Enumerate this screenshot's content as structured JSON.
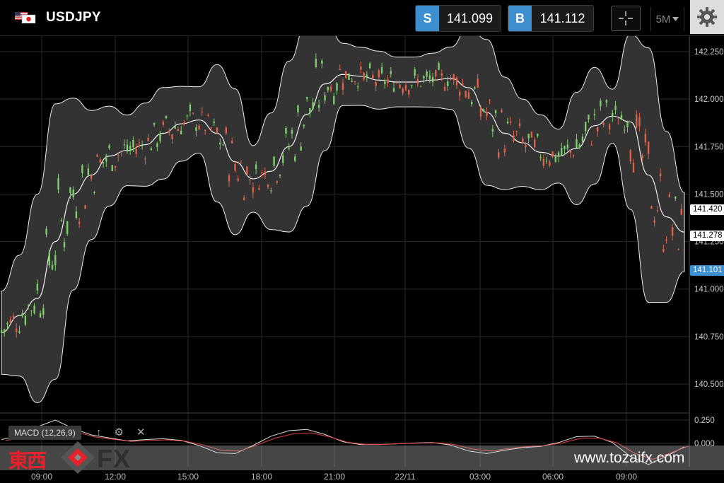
{
  "header": {
    "symbol": "USDJPY",
    "sell_tag": "S",
    "sell_price": "141.099",
    "buy_tag": "B",
    "buy_price": "141.112",
    "timeframe": "5M"
  },
  "price_axis": {
    "ticks": [
      "142.250",
      "142.000",
      "141.750",
      "141.500",
      "141.250",
      "141.000",
      "140.750",
      "140.500"
    ],
    "markers": [
      {
        "label": "141.420",
        "style": "white"
      },
      {
        "label": "141.278",
        "style": "white"
      },
      {
        "label": "141.101",
        "style": "blue"
      }
    ]
  },
  "macd": {
    "label": "MACD (12,26,9)",
    "axis_ticks": [
      "0.250",
      "0.000"
    ]
  },
  "time_axis": [
    "09:00",
    "12:00",
    "15:00",
    "18:00",
    "21:00",
    "22/11",
    "03:00",
    "06:00",
    "09:00"
  ],
  "watermark": {
    "kanji": "東西",
    "fx": "FX",
    "url": "www.tozaifx.com"
  },
  "colors": {
    "accent_blue": "#3d8fd0",
    "up_candle": "#7ccf6a",
    "down_candle": "#e0614a",
    "band_fill": "#333333",
    "macd_signal": "#e04040"
  },
  "chart_data": {
    "type": "candlestick",
    "title": "USDJPY",
    "ylim": [
      140.35,
      142.3
    ],
    "x": [
      "09:00",
      "12:00",
      "15:00",
      "18:00",
      "21:00",
      "22/11",
      "03:00",
      "06:00",
      "09:00"
    ],
    "mid_band": [
      140.77,
      140.86,
      140.95,
      141.25,
      141.5,
      141.6,
      141.7,
      141.73,
      141.76,
      141.82,
      141.87,
      141.89,
      141.82,
      141.67,
      141.58,
      141.62,
      141.75,
      141.92,
      142.08,
      142.13,
      142.12,
      142.1,
      142.09,
      142.09,
      142.1,
      142.11,
      142.06,
      141.93,
      141.82,
      141.77,
      141.72,
      141.7,
      141.74,
      141.86,
      141.91,
      141.88,
      141.6,
      141.38,
      141.3
    ],
    "last_price": 141.101
  }
}
